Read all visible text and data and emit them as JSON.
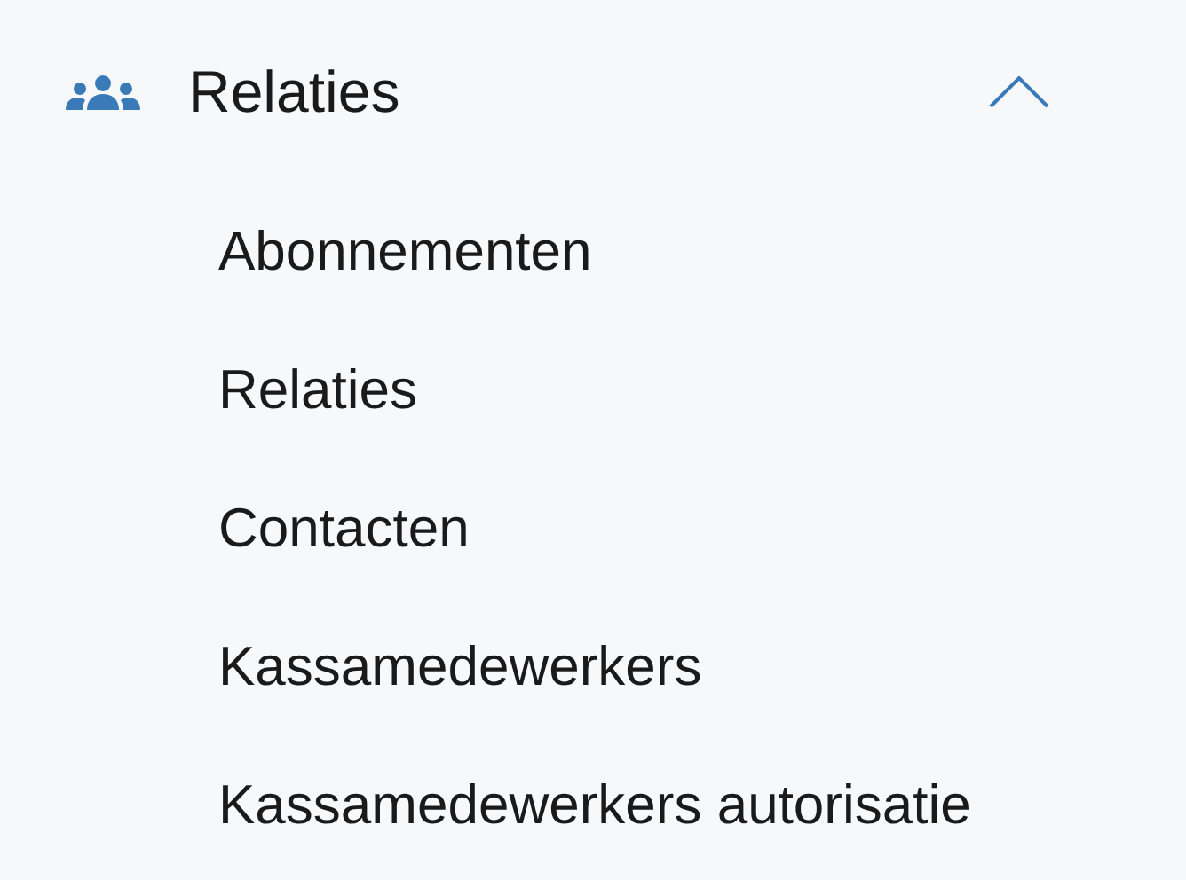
{
  "section": {
    "title": "Relaties",
    "expanded": true,
    "items": [
      {
        "label": "Abonnementen"
      },
      {
        "label": "Relaties"
      },
      {
        "label": "Contacten"
      },
      {
        "label": "Kassamedewerkers"
      },
      {
        "label": "Kassamedewerkers autorisatie"
      }
    ]
  }
}
